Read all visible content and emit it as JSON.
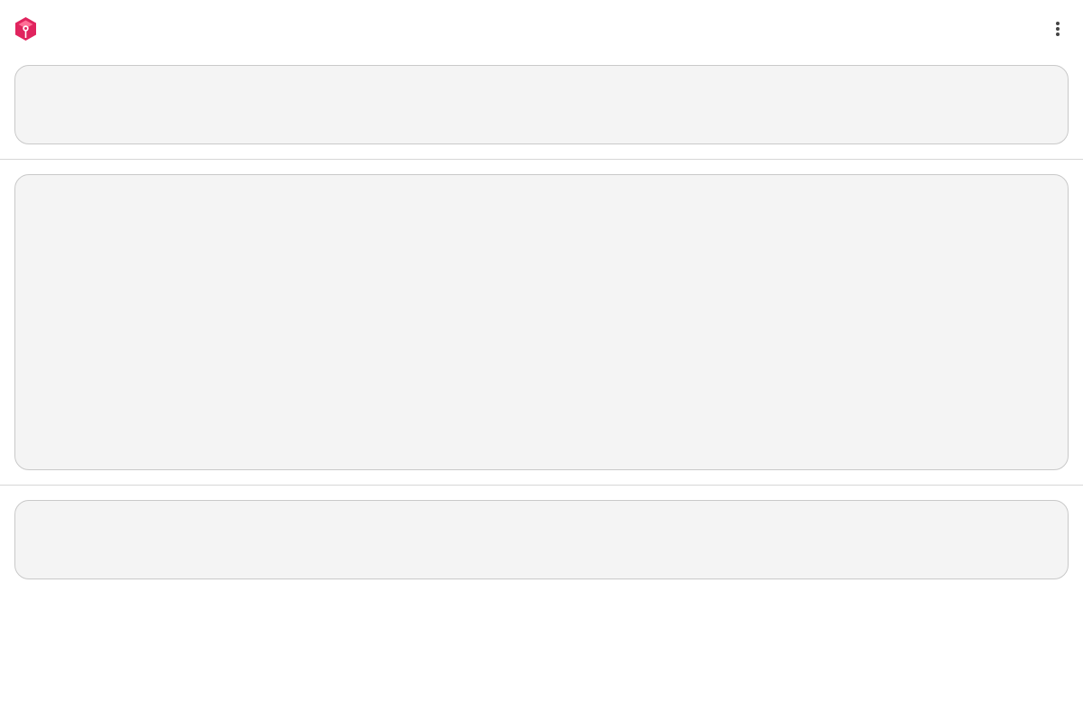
{
  "colors": {
    "brand": "#e0245e",
    "panel_background": "#f4f4f4",
    "panel_border": "#c9c9c9",
    "divider": "#d6d6d6",
    "menu_icon": "#444444"
  },
  "header": {
    "logo_icon": "cube-logo-icon",
    "menu_icon": "more-vertical-icon"
  }
}
